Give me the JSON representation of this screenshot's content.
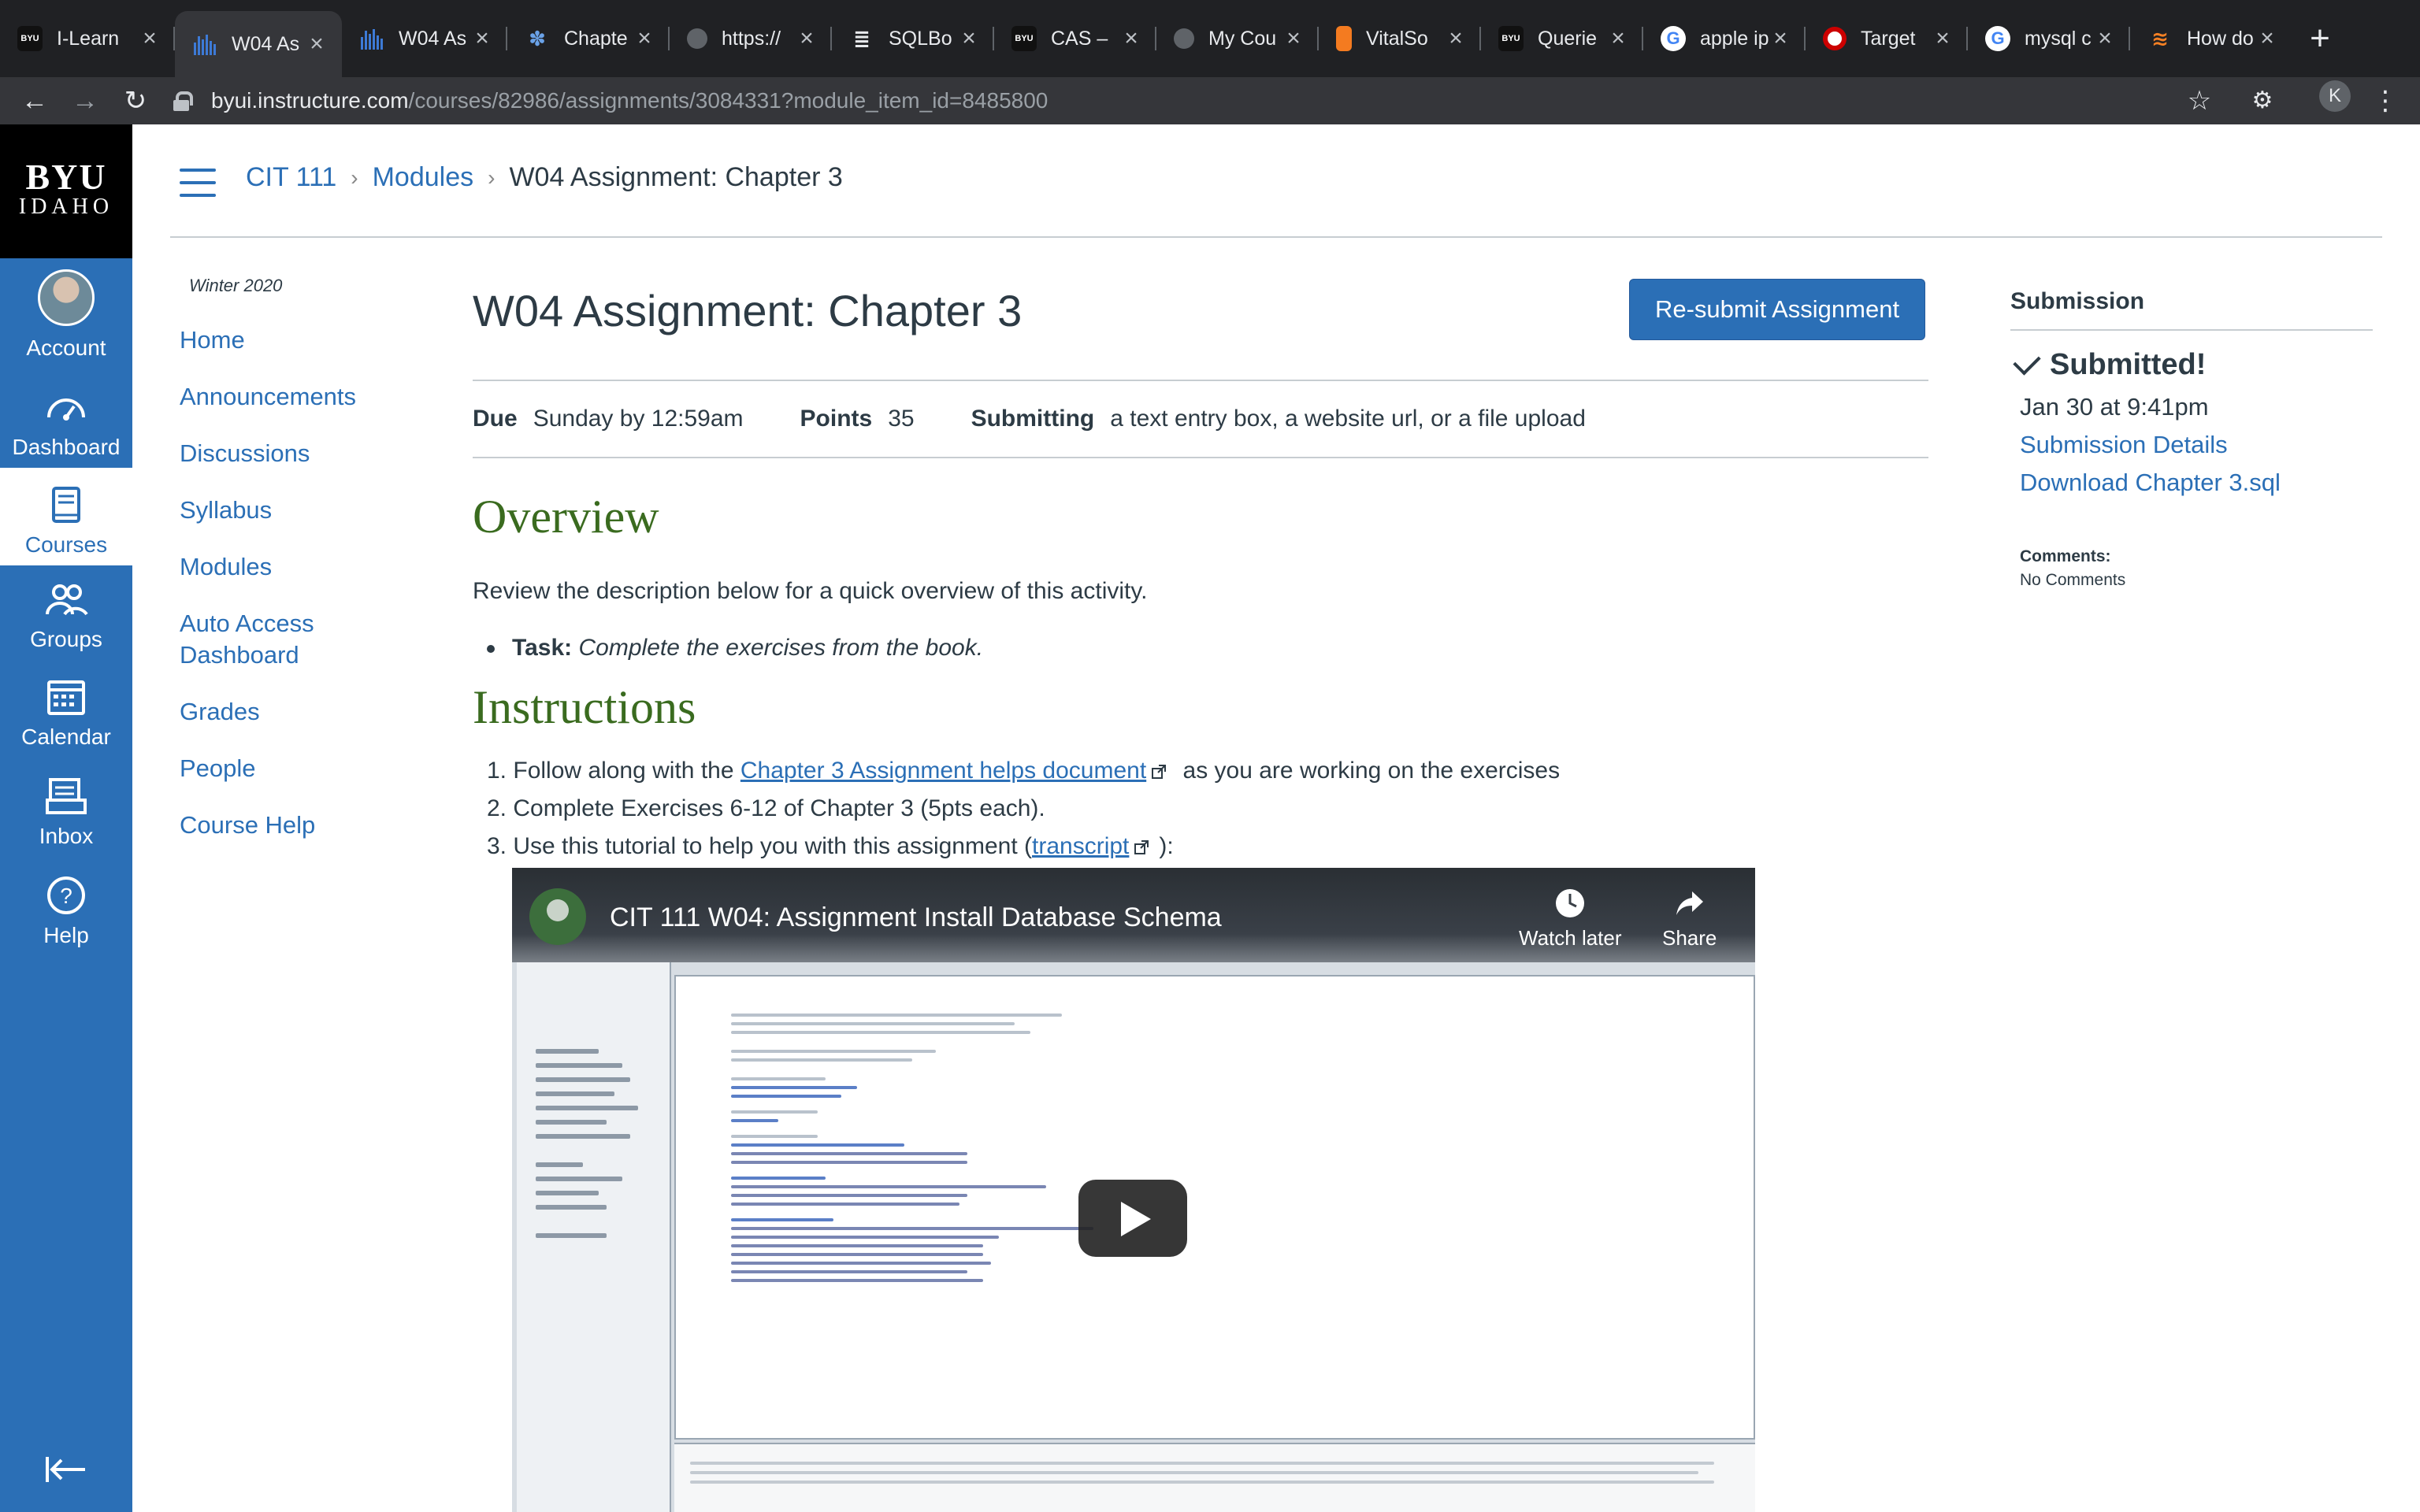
{
  "browser": {
    "tabs": [
      {
        "title": "I-Learn",
        "favicon": "byu-logo-icon"
      },
      {
        "title": "W04 As",
        "favicon": "canvas-chart-icon",
        "active": true
      },
      {
        "title": "W04 As",
        "favicon": "canvas-chart-icon"
      },
      {
        "title": "Chapte",
        "favicon": "bird-icon"
      },
      {
        "title": "https://",
        "favicon": "globe-icon"
      },
      {
        "title": "SQLBo",
        "favicon": "database-icon"
      },
      {
        "title": "CAS –",
        "favicon": "byu-logo-icon"
      },
      {
        "title": "My Cou",
        "favicon": "globe-icon"
      },
      {
        "title": "VitalSo",
        "favicon": "vitalsource-icon"
      },
      {
        "title": "Querie",
        "favicon": "byu-logo-icon"
      },
      {
        "title": "apple ip",
        "favicon": "google-icon"
      },
      {
        "title": "Target",
        "favicon": "target-icon"
      },
      {
        "title": "mysql c",
        "favicon": "google-icon"
      },
      {
        "title": "How do",
        "favicon": "stackoverflow-icon"
      }
    ],
    "url_host": "byui.instructure.com",
    "url_path": "/courses/82986/assignments/3084331?module_item_id=8485800",
    "profile_initial": "K"
  },
  "global_nav": {
    "logo_line1": "BYU",
    "logo_line2": "IDAHO",
    "items": [
      {
        "label": "Account",
        "icon": "avatar"
      },
      {
        "label": "Dashboard",
        "icon": "dashboard-icon"
      },
      {
        "label": "Courses",
        "icon": "book-icon"
      },
      {
        "label": "Groups",
        "icon": "groups-icon"
      },
      {
        "label": "Calendar",
        "icon": "calendar-icon"
      },
      {
        "label": "Inbox",
        "icon": "inbox-icon"
      },
      {
        "label": "Help",
        "icon": "help-icon"
      }
    ]
  },
  "breadcrumb": {
    "course": "CIT 111",
    "modules": "Modules",
    "current": "W04 Assignment: Chapter 3"
  },
  "course_nav": {
    "term": "Winter 2020",
    "items": [
      "Home",
      "Announcements",
      "Discussions",
      "Syllabus",
      "Modules",
      "Auto Access Dashboard",
      "Grades",
      "People",
      "Course Help"
    ]
  },
  "assignment": {
    "title": "W04 Assignment: Chapter 3",
    "resubmit_label": "Re-submit Assignment",
    "due_label": "Due",
    "due_value": "Sunday by 12:59am",
    "points_label": "Points",
    "points_value": "35",
    "submitting_label": "Submitting",
    "submitting_value": "a text entry box, a website url, or a file upload"
  },
  "overview": {
    "heading": "Overview",
    "text": "Review the description below for a quick overview of this activity.",
    "task_label": "Task:",
    "task_text": "Complete the exercises from the book."
  },
  "instructions": {
    "heading": "Instructions",
    "item1_num": "1.",
    "item1_pre": "Follow along with the ",
    "item1_link": "Chapter 3 Assignment helps document",
    "item1_post": " as you are working on the exercises",
    "item2_num": "2.",
    "item2_text": "Complete Exercises 6-12 of Chapter 3 (5pts each).",
    "item3_num": "3.",
    "item3_pre": "Use this tutorial to help you with this assignment (",
    "item3_link": "transcript",
    "item3_post": "):"
  },
  "video": {
    "title": "CIT 111 W04: Assignment Install Database Schema",
    "watch_later": "Watch later",
    "share": "Share"
  },
  "submission": {
    "heading": "Submission",
    "status": "Submitted!",
    "date": "Jan 30 at 9:41pm",
    "details_link": "Submission Details",
    "download_link": "Download Chapter 3.sql",
    "comments_label": "Comments:",
    "comments_value": "No Comments"
  },
  "colors": {
    "canvas_blue": "#2b6fb6",
    "heading_green": "#3a6b1f",
    "text": "#2d3b45"
  }
}
